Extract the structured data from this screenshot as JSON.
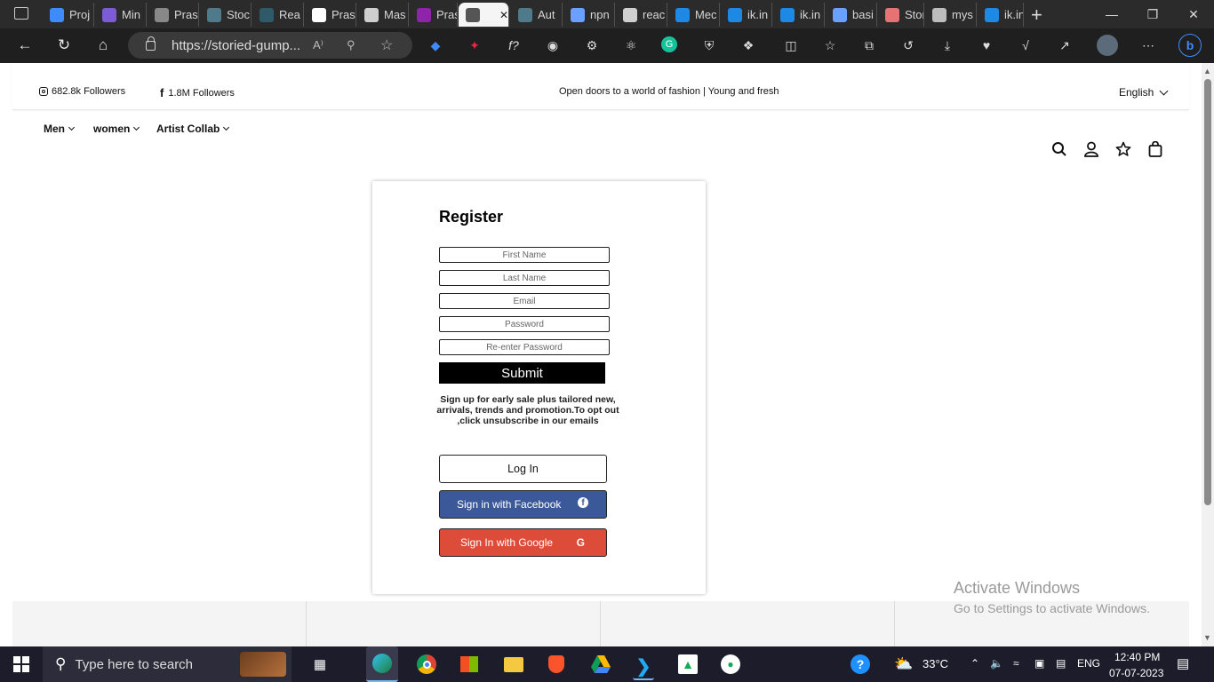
{
  "browser": {
    "tabs": [
      {
        "label": "Proj",
        "color": "#3d8bfd"
      },
      {
        "label": "Min",
        "color": "#7b5cd6"
      },
      {
        "label": "Pras",
        "color": "#888888"
      },
      {
        "label": "Stoc",
        "color": "#4f7a8a"
      },
      {
        "label": "Rea",
        "color": "#2f5a6a"
      },
      {
        "label": "Pras",
        "color": "#ffffff"
      },
      {
        "label": "Mas",
        "color": "#cfcfcf"
      },
      {
        "label": "Pras",
        "color": "#8e24aa"
      },
      {
        "label": "",
        "color": "#555555"
      },
      {
        "label": "Aut",
        "color": "#4f7a8a"
      },
      {
        "label": "npn",
        "color": "#6aa0ff"
      },
      {
        "label": "reac",
        "color": "#cfcfcf"
      },
      {
        "label": "Mec",
        "color": "#1e88e5"
      },
      {
        "label": "ik.in",
        "color": "#1e88e5"
      },
      {
        "label": "ik.in",
        "color": "#1e88e5"
      },
      {
        "label": "basi",
        "color": "#6aa0ff"
      },
      {
        "label": "Stor",
        "color": "#e57373"
      },
      {
        "label": "mys",
        "color": "#bdbdbd"
      },
      {
        "label": "ik.in",
        "color": "#1e88e5"
      }
    ],
    "url": "https://storied-gump...",
    "window_controls": [
      "minimize",
      "restore",
      "close"
    ]
  },
  "site": {
    "instagram_followers": "682.8k Followers",
    "facebook_followers": "1.8M Followers",
    "tagline": "Open doors to a world of fashion | Young and fresh",
    "language": "English",
    "menu": [
      {
        "label": "Men"
      },
      {
        "label": "women"
      },
      {
        "label": "Artist Collab"
      }
    ]
  },
  "register": {
    "title": "Register",
    "fields": [
      {
        "placeholder": "First Name",
        "value": ""
      },
      {
        "placeholder": "Last Name",
        "value": ""
      },
      {
        "placeholder": "Email",
        "value": ""
      },
      {
        "placeholder": "Password",
        "value": ""
      },
      {
        "placeholder": "Re-enter Password",
        "value": ""
      }
    ],
    "submit_label": "Submit",
    "note": "Sign up for early sale plus tailored new, arrivals, trends and promotion.To opt out ,click unsubscribe in our emails",
    "login_label": "Log In",
    "facebook_label": "Sign in with Facebook",
    "google_label": "Sign In with Google",
    "facebook_color": "#3b5998",
    "google_color": "#dd4b39"
  },
  "watermark": {
    "line1": "Activate Windows",
    "line2": "Go to Settings to activate Windows."
  },
  "taskbar": {
    "search_placeholder": "Type here to search",
    "temperature": "33°C",
    "language": "ENG",
    "time": "12:40 PM",
    "date": "07-07-2023"
  }
}
